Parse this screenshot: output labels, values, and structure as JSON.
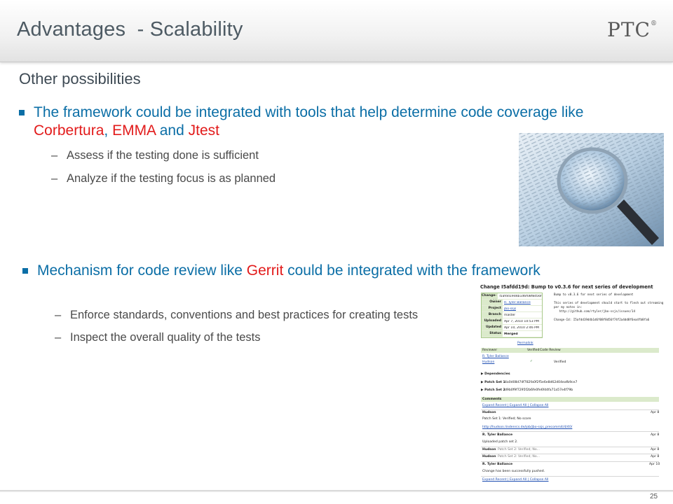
{
  "header": {
    "title": "Advantages  - Scalability",
    "logo": "PTC",
    "logo_mark": "®"
  },
  "subheading": "Other possibilities",
  "bullets": [
    {
      "pre": "The framework could be integrated with tools that help determine code coverage like ",
      "h1": "Corbertura",
      "mid1": ", ",
      "h2": "EMMA",
      "mid2": " and ",
      "h3": "Jtest",
      "subs": [
        "Assess if the testing done is sufficient",
        "Analyze if the testing focus is as planned"
      ]
    },
    {
      "pre": "Mechanism for code review like ",
      "h1": "Gerrit",
      "post": " could be integrated with the framework",
      "subs": [
        "Enforce standards, conventions and best practices for creating tests",
        "Inspect the overall quality of the tests"
      ]
    }
  ],
  "dash": "–",
  "gerrit": {
    "title": "Change I5afdd19d: Bump to v0.3.6 for next series of development",
    "rows": [
      {
        "k": "Change-Id",
        "v": "I5afdd19d4b1d6f08f8d56f74f2a4dd8f6ea4fb8fa6"
      },
      {
        "k": "Owner",
        "v": "R. Tyler Ballance"
      },
      {
        "k": "Project",
        "v": "jbo-ssjs"
      },
      {
        "k": "Branch",
        "v": "master"
      },
      {
        "k": "Uploaded",
        "v": "Apr 7, 2010 10:53 PM"
      },
      {
        "k": "Updated",
        "v": "Apr 10, 2010 2:46 PM"
      },
      {
        "k": "Status",
        "v": "Merged"
      }
    ],
    "permalink": "Permalink",
    "message": "Bump to v0.3.6 for next series of development\n\nThis series of development should start to flesh out streaming,\nper my notes in:\n   http://github.com/rtyler/jbo-ssjs/issues/14\n\nChange-Id: I5afdd19d4b1d6f08f8d56f74f2a4dd8f6ea4fb8fa6",
    "review_headers": [
      "Reviewer",
      "Verified",
      "Code Review"
    ],
    "reviewers": [
      {
        "name": "R. Tyler Ballance",
        "verified": "",
        "review": ""
      },
      {
        "name": "Hudson",
        "verified": "✓",
        "review": "Verified"
      }
    ],
    "dependencies": "Dependencies",
    "patch_sets": [
      {
        "label": "Patch Set 1",
        "hash": "4a0d08d74f782fa0f2f5e6e8d62d04eafb9ce7"
      },
      {
        "label": "Patch Set 2",
        "hash": "d9b0f9f7295f2b6fe0fe6fd4fa71a57e4f79b"
      }
    ],
    "comments": "Comments",
    "expand_links": "Expand Recent | Expand All | Collapse All",
    "comment_items": [
      {
        "author": "Hudson",
        "date": "Apr 8",
        "lines": [
          "Patch Set 1: Verified; No score",
          "",
          "http://hudson.lindenrcs.de/job/jbo-ssjs_precommit/4/40/"
        ]
      },
      {
        "author": "R. Tyler Ballance",
        "date": "Apr 8",
        "lines": [
          "Uploaded patch set 2."
        ]
      },
      {
        "author": "Hudson",
        "date": "Apr 8",
        "lines": [
          "Patch Set 2: Verified; No..."
        ]
      },
      {
        "author": "Hudson",
        "date": "Apr 8",
        "lines": [
          "Patch Set 2: Verified; No..."
        ]
      },
      {
        "author": "R. Tyler Ballance",
        "date": "Apr 10",
        "lines": [
          "Change has been successfully pushed."
        ]
      }
    ]
  },
  "page_number": "25"
}
